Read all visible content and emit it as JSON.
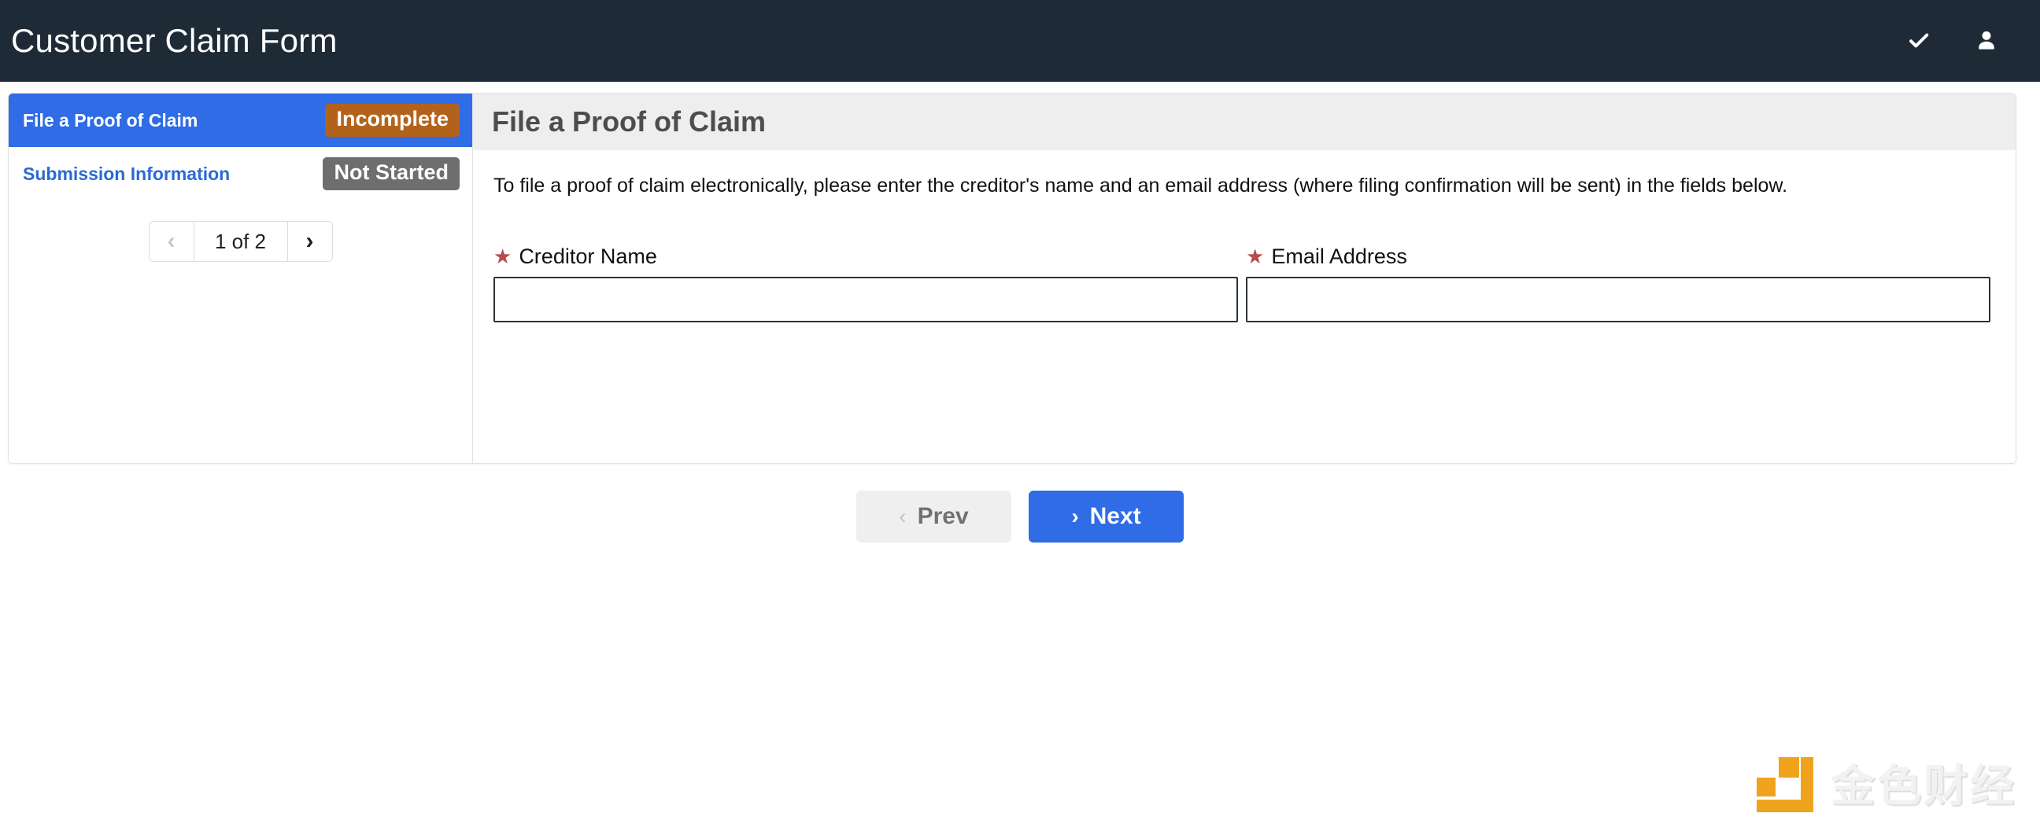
{
  "appbar": {
    "title": "Customer Claim Form",
    "icons": [
      {
        "name": "check-icon",
        "glyph": "✔"
      },
      {
        "name": "user-icon",
        "glyph": "👤"
      }
    ]
  },
  "sidebar": {
    "items": [
      {
        "label": "File a Proof of Claim",
        "status": "Incomplete",
        "status_color": "#b3621b",
        "active": true
      },
      {
        "label": "Submission Information",
        "status": "Not Started",
        "status_color": "#6e6e6e",
        "active": false
      }
    ],
    "pager": {
      "prev_glyph": "‹",
      "next_glyph": "›",
      "count_label": "1 of 2",
      "current_page": 1,
      "total_pages": 2,
      "prev_enabled": false,
      "next_enabled": true
    }
  },
  "main": {
    "title": "File a Proof of Claim",
    "intro": "To file a proof of claim electronically, please enter the creditor's name and an email address (where filing confirmation will be sent) in the fields below.",
    "fields": [
      {
        "label": "Creditor Name",
        "required": true,
        "required_marker": "★",
        "value": "",
        "placeholder": ""
      },
      {
        "label": "Email Address",
        "required": true,
        "required_marker": "★",
        "value": "",
        "placeholder": ""
      }
    ]
  },
  "footer_nav": {
    "prev": {
      "label": "Prev",
      "glyph": "‹",
      "enabled": false
    },
    "next": {
      "label": "Next",
      "glyph": "›",
      "enabled": true
    }
  },
  "watermark": {
    "text": "金色财经"
  },
  "colors": {
    "appbar_bg": "#1e2a36",
    "accent_blue": "#2f6ce5",
    "badge_incomplete": "#b3621b",
    "badge_notstarted": "#6e6e6e",
    "panel_head_bg": "#eeeeee",
    "required_star": "#b54b4b",
    "watermark_orange": "#efa31d"
  }
}
